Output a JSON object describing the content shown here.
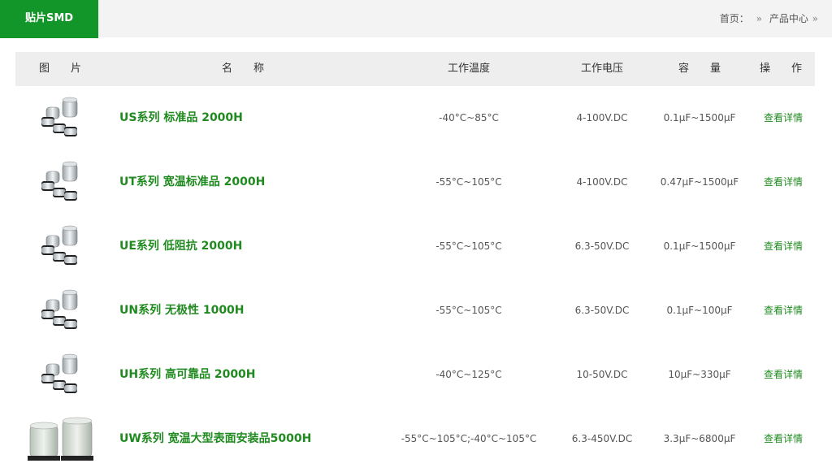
{
  "header": {
    "active_tab": "贴片SMD",
    "breadcrumb": {
      "home": "首页：",
      "sep1": "»",
      "current": "产品中心",
      "sep2": "»"
    }
  },
  "table": {
    "columns": {
      "image": "图　　片",
      "name": "名　　称",
      "temp": "工作温度",
      "voltage": "工作电压",
      "capacity": "容　　量",
      "action": "操　　作"
    },
    "rows": [
      {
        "name": "US系列 标准品 2000H",
        "temp": "-40°C~85°C",
        "voltage": "4-100V.DC",
        "capacity": "0.1μF~1500μF",
        "action": "查看详情",
        "image_icon": "smd-capacitor-group-icon"
      },
      {
        "name": "UT系列 宽温标准品 2000H",
        "temp": "-55°C~105°C",
        "voltage": "4-100V.DC",
        "capacity": "0.47μF~1500μF",
        "action": "查看详情",
        "image_icon": "smd-capacitor-group-icon"
      },
      {
        "name": "UE系列 低阻抗 2000H",
        "temp": "-55°C~105°C",
        "voltage": "6.3-50V.DC",
        "capacity": "0.1μF~1500μF",
        "action": "查看详情",
        "image_icon": "smd-capacitor-group-icon"
      },
      {
        "name": "UN系列 无极性 1000H",
        "temp": "-55°C~105°C",
        "voltage": "6.3-50V.DC",
        "capacity": "0.1μF~100μF",
        "action": "查看详情",
        "image_icon": "smd-capacitor-group-icon"
      },
      {
        "name": "UH系列 高可靠品 2000H",
        "temp": "-40°C~125°C",
        "voltage": "10-50V.DC",
        "capacity": "10μF~330μF",
        "action": "查看详情",
        "image_icon": "smd-capacitor-group-icon"
      },
      {
        "name": "UW系列 宽温大型表面安装品5000H",
        "temp": "-55°C~105°C;-40°C~105°C",
        "voltage": "6.3-450V.DC",
        "capacity": "3.3μF~6800μF",
        "action": "查看详情",
        "image_icon": "smd-capacitor-pair-icon"
      }
    ]
  },
  "colors": {
    "brand_green": "#129629",
    "link_green": "#1f8a1f",
    "header_bg": "#f3f3f3",
    "table_head_bg": "#eeeeee"
  }
}
